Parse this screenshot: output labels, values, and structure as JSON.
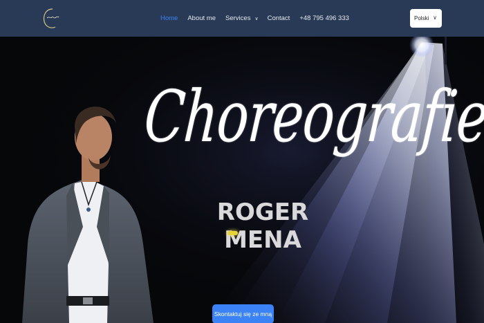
{
  "header": {
    "logo_icon": "signature-logo-icon",
    "nav": [
      {
        "label": "Home",
        "active": true
      },
      {
        "label": "About me"
      },
      {
        "label": "Services",
        "has_dropdown": true
      },
      {
        "label": "Contact"
      },
      {
        "label": "+48 795 496 333"
      }
    ],
    "language": {
      "selected": "Polski",
      "icon": "chevron-down-icon"
    }
  },
  "hero": {
    "title": "Choreografie",
    "name": "ROGER MENA",
    "cta_label": "Skontaktuj się ze mną"
  },
  "colors": {
    "header_bg": "#283a55",
    "accent": "#3b82f6",
    "hero_bg": "#060709"
  }
}
